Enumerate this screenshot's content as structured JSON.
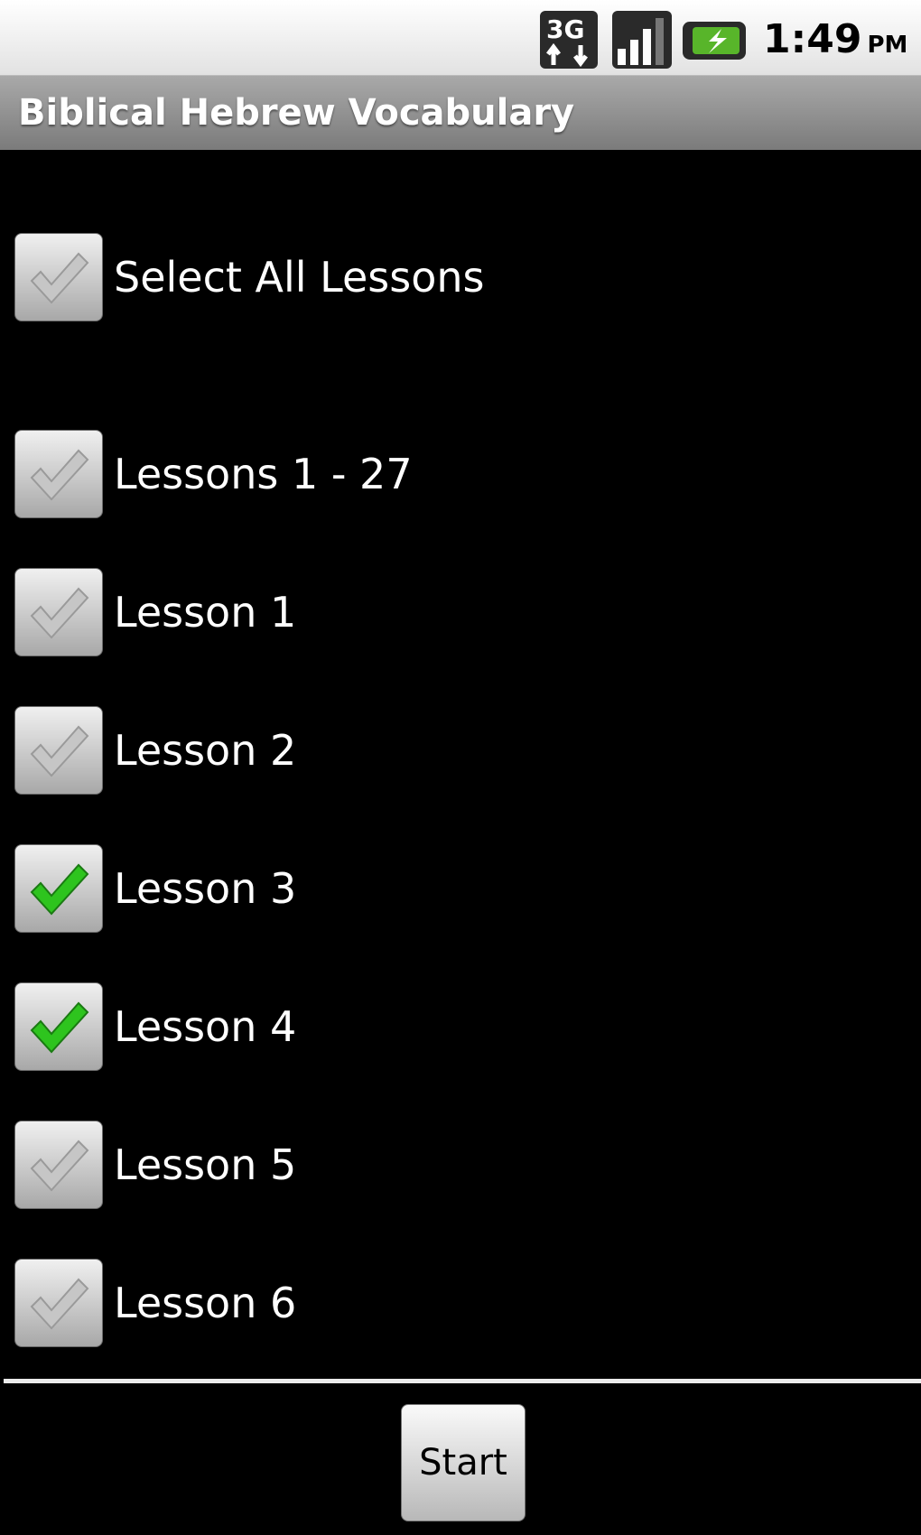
{
  "status_bar": {
    "network_label": "3G",
    "network_icon": "network-3g-icon",
    "signal_icon": "signal-strength-icon",
    "battery_icon": "battery-charging-icon",
    "time": "1:49",
    "ampm": "PM"
  },
  "app": {
    "title": "Biblical Hebrew Vocabulary"
  },
  "select_all": {
    "label": "Select All Lessons",
    "checked": false
  },
  "lessons": [
    {
      "label": "Lessons 1 - 27",
      "checked": false
    },
    {
      "label": "Lesson 1",
      "checked": false
    },
    {
      "label": "Lesson 2",
      "checked": false
    },
    {
      "label": "Lesson 3",
      "checked": true
    },
    {
      "label": "Lesson 4",
      "checked": true
    },
    {
      "label": "Lesson 5",
      "checked": false
    },
    {
      "label": "Lesson 6",
      "checked": false
    }
  ],
  "footer": {
    "start_label": "Start"
  },
  "colors": {
    "check_on": "#2ec41e",
    "check_off": "#c6c6c6",
    "background": "#000000"
  }
}
